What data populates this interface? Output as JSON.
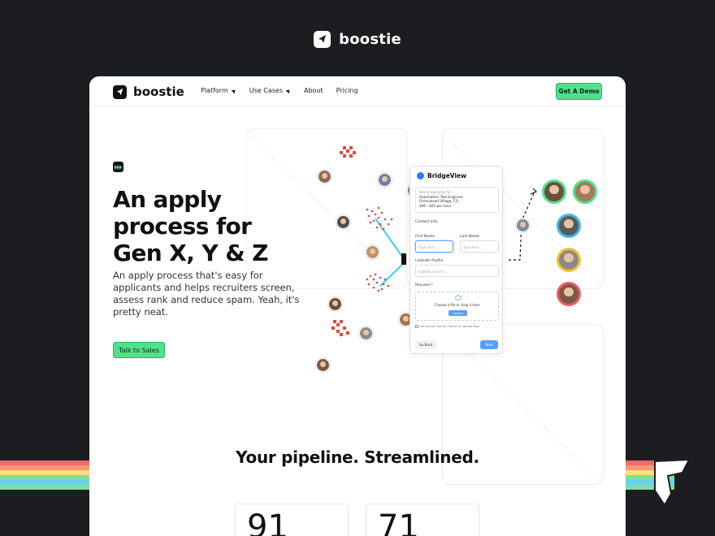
{
  "brand": {
    "name": "boostie"
  },
  "nav": {
    "items": [
      {
        "label": "Platform",
        "has_caret": true
      },
      {
        "label": "Use Cases",
        "has_caret": true
      },
      {
        "label": "About",
        "has_caret": false
      },
      {
        "label": "Pricing",
        "has_caret": false
      }
    ],
    "cta_label": "Get A Demo"
  },
  "hero": {
    "badge_icon": "fast-forward-icon",
    "title": "An apply process for Gen X, Y & Z",
    "subtitle": "An apply process that's easy for applicants and helps recruiters screen, assess rank and reduce spam. Yeah, it's pretty neat.",
    "cta_label": "Talk to Sales"
  },
  "form_card": {
    "brand": "BridgeView",
    "job_intro": "You're applying for",
    "job_title": "Automation Test Engineer",
    "job_location": "Greenwood Village, CO",
    "job_pay": "$60 - $65 per hour",
    "section_contact": "Contact Info",
    "first_name_label": "First Name",
    "first_name_placeholder": "Type here...",
    "last_name_label": "Last Name",
    "last_name_placeholder": "Type here...",
    "linkedin_label": "LinkedIn Profile",
    "linkedin_placeholder": "linkedin.com/in/...",
    "resume_label": "Resume *",
    "drop_text": "Choose a file or drag it here",
    "upload_label": "Upload",
    "checkbox_text": "No resume handy? Select to upload later",
    "back_label": "Go Back",
    "next_label": "Next"
  },
  "pipeline": {
    "title": "Your pipeline. Streamlined.",
    "stats": [
      "91",
      "71"
    ]
  },
  "colors": {
    "background": "#1c1d21",
    "accent_green": "#52e08a",
    "spam_red": "#e04a3a",
    "link_cyan": "#2fd6f0",
    "ring_colors": [
      "#52e08a",
      "#52e08a",
      "#3fb6e6",
      "#f2c22f",
      "#ee5a6a"
    ],
    "stripes": [
      "#f26a6a",
      "#f59a74",
      "#f5e27a",
      "#7ee0a0",
      "#6ad0ea",
      "#7ee0a0"
    ]
  }
}
